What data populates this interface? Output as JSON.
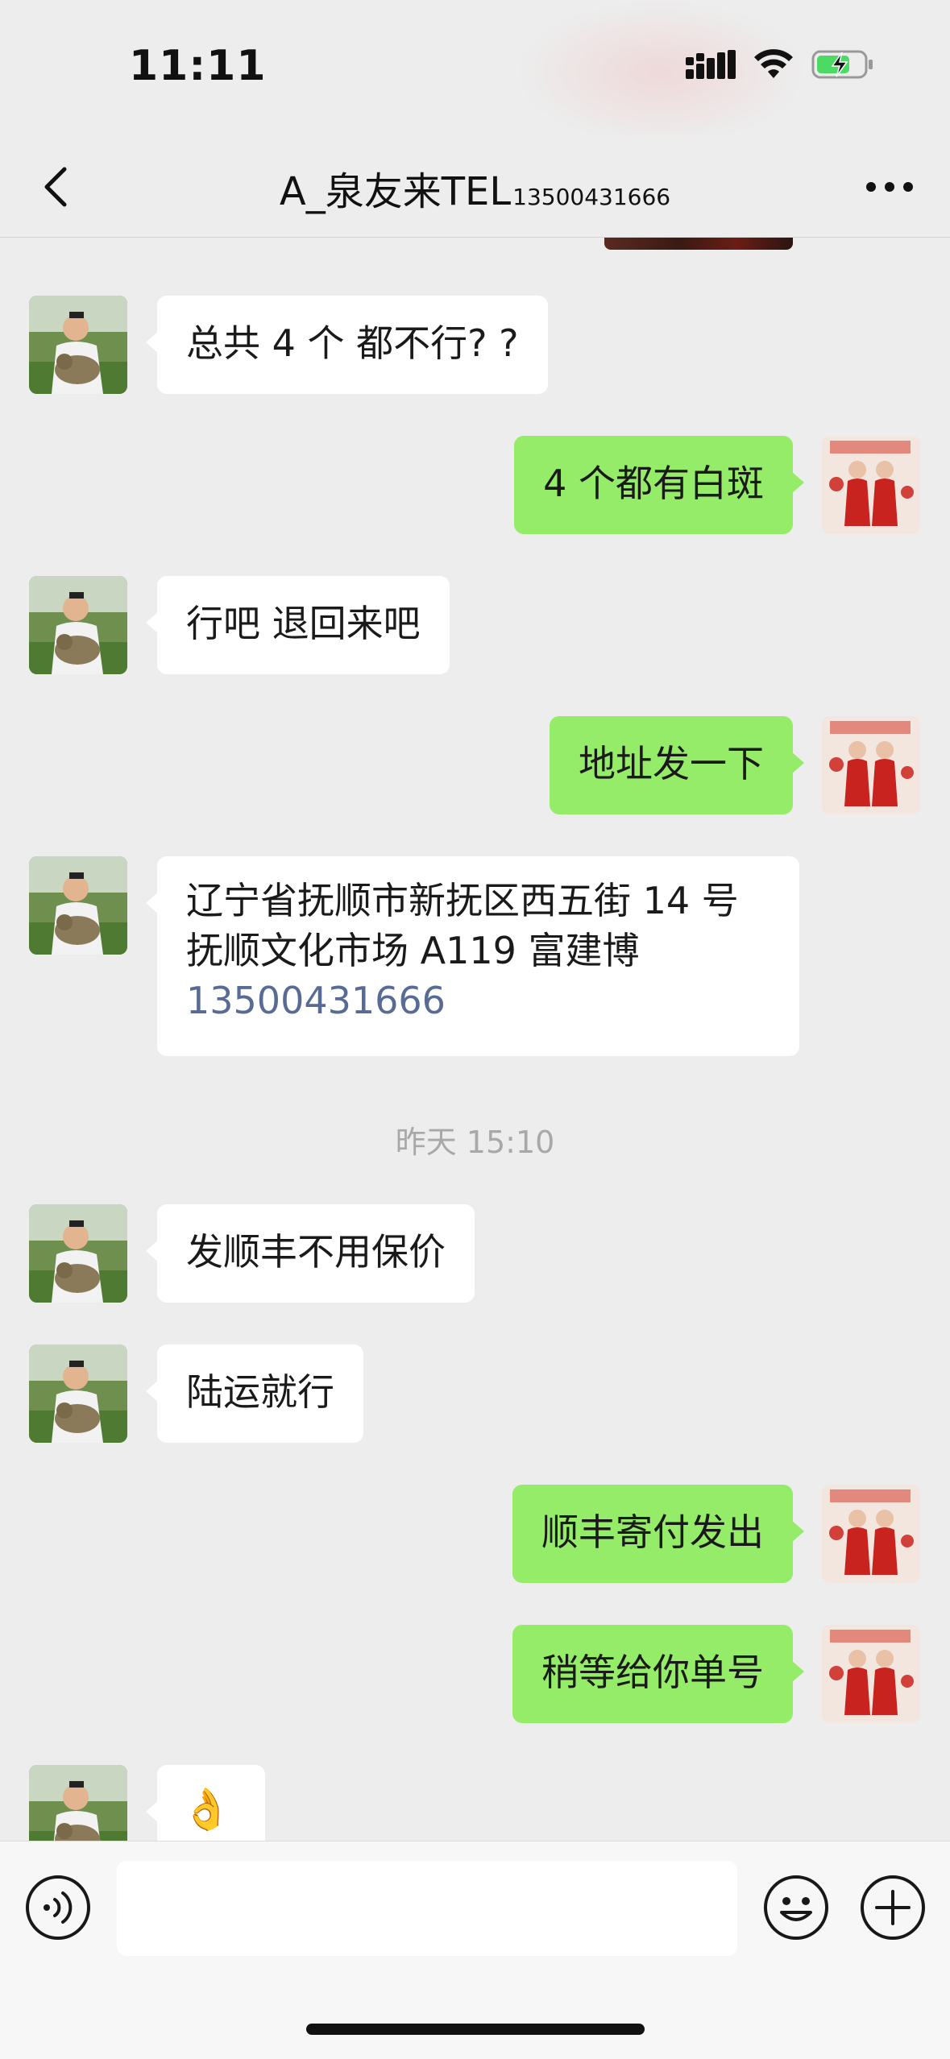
{
  "status_bar": {
    "time": "11:11"
  },
  "header": {
    "title": "A_泉友来TEL",
    "title_phone": "13500431666"
  },
  "messages": [
    {
      "side": "in",
      "text": "总共 4 个  都不行? ?"
    },
    {
      "side": "out",
      "text": "4 个都有白斑"
    },
    {
      "side": "in",
      "text": "行吧 退回来吧"
    },
    {
      "side": "out",
      "text": "地址发一下"
    },
    {
      "side": "in",
      "lines": [
        "辽宁省抚顺市新抚区西五街 14 号",
        "抚顺文化市场 A119  富建博"
      ],
      "phone": "13500431666"
    },
    {
      "side": "in",
      "text": "发顺丰不用保价"
    },
    {
      "side": "in",
      "text": "陆运就行"
    },
    {
      "side": "out",
      "text": "顺丰寄付发出"
    },
    {
      "side": "out",
      "text": "稍等给你单号"
    },
    {
      "side": "in",
      "text": "👌"
    }
  ],
  "timestamp": "昨天 15:10",
  "colors": {
    "background": "#ededed",
    "incoming_bubble": "#ffffff",
    "outgoing_bubble": "#95ec69",
    "link": "#576b95",
    "timestamp": "#a8a8a8"
  },
  "icons": {
    "back": "chevron-left-icon",
    "more": "more-dots-icon",
    "voice": "voice-icon",
    "emoji": "emoji-icon",
    "plus": "plus-icon",
    "signal": "signal-icon",
    "wifi": "wifi-icon",
    "battery": "battery-charging-icon"
  }
}
